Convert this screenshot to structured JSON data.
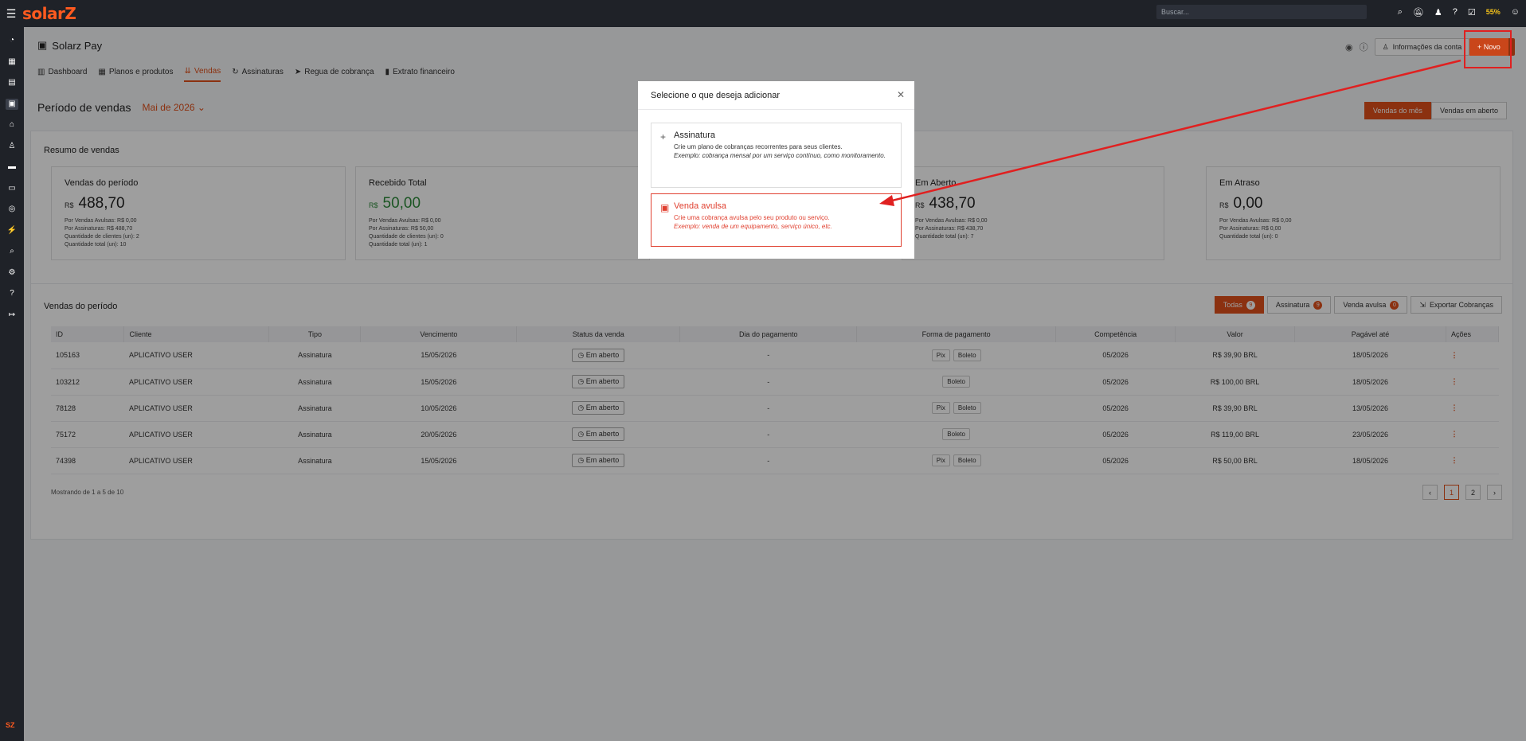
{
  "topbar": {
    "logo": "solarZ",
    "search_placeholder": "Buscar...",
    "icons": [
      "search-icon",
      "bell-off-icon",
      "people-icon",
      "help-icon",
      "clipboard-icon",
      "trophy-icon",
      "user-menu-icon"
    ],
    "progress_label": "55%"
  },
  "sidebar": {
    "icons": [
      "dashboard-icon",
      "grid-icon",
      "document-icon",
      "pay-icon",
      "home-icon",
      "user-icon",
      "list-icon",
      "card-icon",
      "whatsapp-icon",
      "plug-icon",
      "search-icon",
      "settings-icon",
      "help-icon",
      "logout-icon"
    ],
    "footer": "SZ"
  },
  "header": {
    "title": "Solarz Pay",
    "tabs": [
      {
        "label": "Dashboard",
        "icon": "chart-icon",
        "active": false
      },
      {
        "label": "Planos e produtos",
        "icon": "box-icon",
        "active": false
      },
      {
        "label": "Vendas",
        "icon": "sales-icon",
        "active": true
      },
      {
        "label": "Assinaturas",
        "icon": "refresh-icon",
        "active": false
      },
      {
        "label": "Regua de cobrança",
        "icon": "send-icon",
        "active": false
      },
      {
        "label": "Extrato financeiro",
        "icon": "book-icon",
        "active": false
      }
    ],
    "account_button": "Informações da conta",
    "new_button": "+ Novo"
  },
  "period": {
    "label": "Período de vendas",
    "month": "Mai de 2026",
    "buttons": [
      "Vendas do mês",
      "Vendas em aberto"
    ]
  },
  "summary": {
    "title": "Resumo de vendas",
    "cards": [
      {
        "title": "Vendas do período",
        "currency": "R$",
        "value": "488,70",
        "lines": [
          "Por Vendas Avulsas: R$ 0,00",
          "Por Assinaturas: R$ 488,70",
          "Quantidade de clientes (un): 2",
          "Quantidade total (un): 10"
        ]
      },
      {
        "title": "Recebido Total",
        "currency": "R$",
        "value": "50,00",
        "lines": [
          "Por Vendas Avulsas: R$ 0,00",
          "Por Assinaturas: R$ 50,00",
          "Quantidade de clientes (un): 0",
          "Quantidade total (un): 1"
        ]
      },
      {
        "title": "Em Aberto",
        "currency": "R$",
        "value": "438,70",
        "lines": [
          "Por Vendas Avulsas: R$ 0,00",
          "Por Assinaturas: R$ 438,70",
          "Quantidade total (un): 7"
        ]
      },
      {
        "title": "Em Atraso",
        "currency": "R$",
        "value": "0,00",
        "lines": [
          "Por Vendas Avulsas: R$ 0,00",
          "Por Assinaturas: R$ 0,00",
          "Quantidade total (un): 0"
        ]
      }
    ]
  },
  "sales": {
    "title": "Vendas do período",
    "filters": [
      {
        "label": "Todas",
        "count": "9"
      },
      {
        "label": "Assinatura",
        "count": "9"
      },
      {
        "label": "Venda avulsa",
        "count": "0"
      }
    ],
    "export_label": "Exportar Cobranças",
    "columns": [
      "ID",
      "Cliente",
      "Tipo",
      "Vencimento",
      "Status da venda",
      "Dia do pagamento",
      "Forma de pagamento",
      "Competência",
      "Valor",
      "Pagável até",
      "Ações"
    ],
    "rows": [
      {
        "id": "105163",
        "client": "APLICATIVO USER",
        "type": "Assinatura",
        "due": "15/05/2026",
        "status": "Em aberto",
        "payday": "-",
        "methods": [
          "Pix",
          "Boleto"
        ],
        "comp": "05/2026",
        "value": "R$ 39,90 BRL",
        "until": "18/05/2026"
      },
      {
        "id": "103212",
        "client": "APLICATIVO USER",
        "type": "Assinatura",
        "due": "15/05/2026",
        "status": "Em aberto",
        "payday": "-",
        "methods": [
          "Boleto"
        ],
        "comp": "05/2026",
        "value": "R$ 100,00 BRL",
        "until": "18/05/2026"
      },
      {
        "id": "78128",
        "client": "APLICATIVO USER",
        "type": "Assinatura",
        "due": "10/05/2026",
        "status": "Em aberto",
        "payday": "-",
        "methods": [
          "Pix",
          "Boleto"
        ],
        "comp": "05/2026",
        "value": "R$ 39,90 BRL",
        "until": "13/05/2026"
      },
      {
        "id": "75172",
        "client": "APLICATIVO USER",
        "type": "Assinatura",
        "due": "20/05/2026",
        "status": "Em aberto",
        "payday": "-",
        "methods": [
          "Boleto"
        ],
        "comp": "05/2026",
        "value": "R$ 119,00 BRL",
        "until": "23/05/2026"
      },
      {
        "id": "74398",
        "client": "APLICATIVO USER",
        "type": "Assinatura",
        "due": "15/05/2026",
        "status": "Em aberto",
        "payday": "-",
        "methods": [
          "Pix",
          "Boleto"
        ],
        "comp": "05/2026",
        "value": "R$ 50,00 BRL",
        "until": "18/05/2026"
      }
    ],
    "showing": "Mostrando de 1 a 5 de 10",
    "pages": [
      "1",
      "2"
    ]
  },
  "modal": {
    "title": "Selecione o que deseja adicionar",
    "options": [
      {
        "title": "Assinatura",
        "description": "Crie um plano de cobranças recorrentes para seus clientes.",
        "example": "Exemplo: cobrança mensal por um serviço contínuo, como monitoramento.",
        "icon": "plus-icon"
      },
      {
        "title": "Venda avulsa",
        "description": "Crie uma cobrança avulsa pelo seu produto ou serviço.",
        "example": "Exemplo: venda de um equipamento, serviço único, etc.",
        "icon": "ticket-icon"
      }
    ]
  },
  "colors": {
    "accent": "#e0501a",
    "topbar": "#1f2228",
    "annotation": "#e02020",
    "green": "#2e8b3a"
  }
}
